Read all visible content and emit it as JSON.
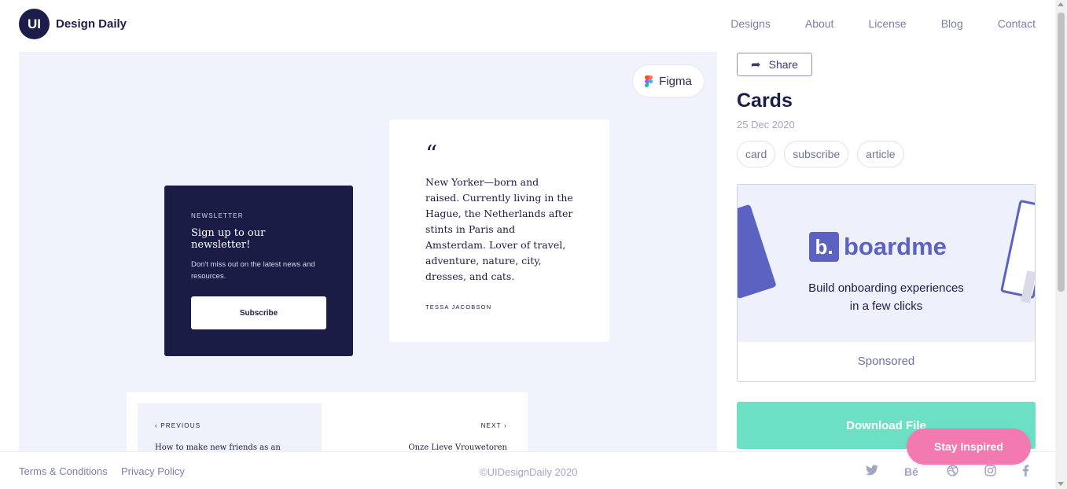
{
  "header": {
    "logo_badge": "UI",
    "logo_text": "Design Daily",
    "nav": [
      "Designs",
      "About",
      "License",
      "Blog",
      "Contact"
    ]
  },
  "preview": {
    "figma_label": "Figma",
    "newsletter": {
      "eyebrow": "NEWSLETTER",
      "title": "Sign up to our newsletter!",
      "description": "Don't miss out on the latest news and resources.",
      "button": "Subscribe"
    },
    "quote": {
      "mark": "“",
      "text": "New Yorker—born and raised. Currently living in the Hague, the Netherlands after stints in Paris and Amsterdam. Lover of travel, adventure, nature, city, dresses, and cats.",
      "author": "TESSA JACOBSON"
    },
    "pager": {
      "prev_label": "PREVIOUS",
      "prev_title": "How to make new friends as an",
      "next_label": "NEXT",
      "next_title": "Onze Lieve Vrouwetoren"
    }
  },
  "sidebar": {
    "share_label": "Share",
    "title": "Cards",
    "date": "25 Dec 2020",
    "tags": [
      "card",
      "subscribe",
      "article"
    ],
    "sponsor": {
      "brand_mark": "b.",
      "brand_name": "boardme",
      "tagline_line1": "Build onboarding experiences",
      "tagline_line2": "in a few clicks",
      "label": "Sponsored"
    },
    "download_label": "Download File",
    "stay_inspired_label": "Stay Inspired"
  },
  "footer": {
    "terms": "Terms & Conditions",
    "privacy": "Privacy Policy",
    "copyright": "©UIDesignDaily 2020",
    "socials": [
      "twitter-icon",
      "behance-icon",
      "dribbble-icon",
      "instagram-icon",
      "facebook-icon"
    ]
  },
  "colors": {
    "navy": "#1c1d4a",
    "preview_bg": "#f0f2fc",
    "download": "#6be0c4",
    "stay_inspired": "#f27ab1",
    "boardme": "#5b62c2"
  }
}
